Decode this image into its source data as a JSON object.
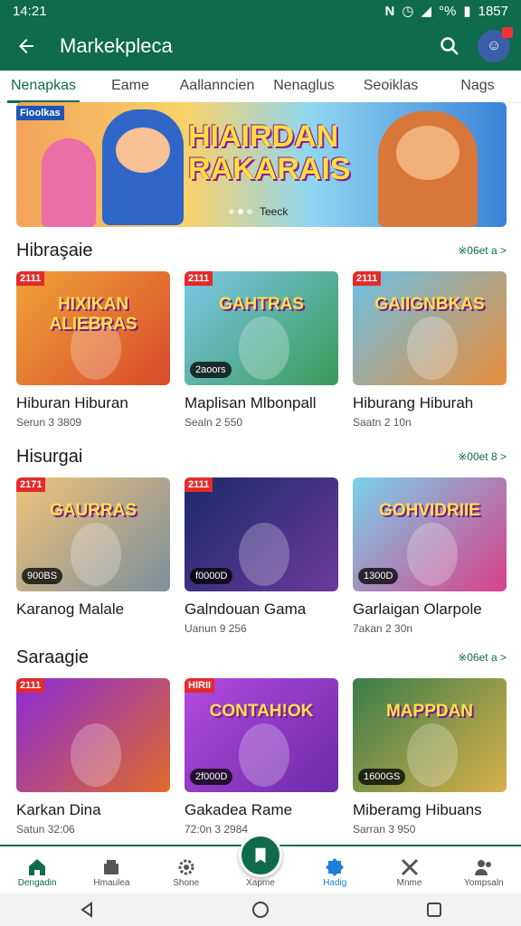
{
  "status": {
    "time": "14:21",
    "battery_text": "°%",
    "clock_right": "1857"
  },
  "appbar": {
    "title": "Markekpleca",
    "search_icon": "search-icon",
    "back_icon": "back-arrow-icon"
  },
  "tabs": [
    {
      "label": "Nenapkas",
      "active": true
    },
    {
      "label": "Eame"
    },
    {
      "label": "Aallanncien"
    },
    {
      "label": "Nenaglus"
    },
    {
      "label": "Seoiklas"
    },
    {
      "label": "Nags"
    }
  ],
  "banner": {
    "tag": "Fioolkas",
    "headline_line1": "HIAIRDAN",
    "headline_line2": "RAKARAIS",
    "caption": "Teeck",
    "pages": 3,
    "active_page": 2
  },
  "sections": [
    {
      "title": "Hibraşaie",
      "more": "※06et a >",
      "cards": [
        {
          "name": "Hiburan Hiburan",
          "meta": "Serun 3 3809",
          "ribbon": "2111",
          "cover_text": "HIXIKAN ALIEBRAS",
          "colors": [
            "#f0a33a",
            "#d84a2a"
          ]
        },
        {
          "name": "Maplisan Mlbonpall",
          "meta": "Sealn 2 550",
          "ribbon": "2111",
          "pill": "2aoors",
          "cover_text": "GAHTRAS",
          "colors": [
            "#7cc7e8",
            "#3a9b5a"
          ]
        },
        {
          "name": "Hiburang Hiburah",
          "meta": "Saatn 2 10n",
          "ribbon": "2111",
          "cover_text": "GAIIGNBKAS",
          "colors": [
            "#6bc0e6",
            "#e88d3a"
          ]
        }
      ]
    },
    {
      "title": "Hisurgai",
      "more": "※00et 8 >",
      "cards": [
        {
          "name": "Karanog Malale",
          "meta": "",
          "ribbon": "2171",
          "pill": "900BS",
          "cover_text": "GAURRAS",
          "colors": [
            "#f1c27a",
            "#7c8f9c"
          ]
        },
        {
          "name": "Galndouan Gama",
          "meta": "Uanun 9 256",
          "ribbon": "2111",
          "pill": "f0000D",
          "cover_text": "",
          "colors": [
            "#1b2a6b",
            "#6b3a9b"
          ]
        },
        {
          "name": "Garlaigan Olarpole",
          "meta": "7akan 2 30n",
          "ribbon": "",
          "pill": "1300D",
          "cover_text": "GOHVIDRIIE",
          "colors": [
            "#7ad1ea",
            "#d8408a"
          ]
        }
      ]
    },
    {
      "title": "Saraagie",
      "more": "※06et a >",
      "cards": [
        {
          "name": "Karkan Dina",
          "meta": "Satun 32:06",
          "ribbon": "2111",
          "cover_text": "",
          "colors": [
            "#8a2bd8",
            "#e06a2a"
          ]
        },
        {
          "name": "Gakadea Rame",
          "meta": "72:0n 3 2984",
          "ribbon": "HIRII",
          "pill": "2f000D",
          "cover_text": "CONTAH!OK",
          "colors": [
            "#b34adf",
            "#6b2aa8"
          ]
        },
        {
          "name": "Miberamg Hibuans",
          "meta": "Sarran 3 950",
          "ribbon": "",
          "pill": "1600GS",
          "cover_text": "MAPPDAN",
          "colors": [
            "#3a7d4a",
            "#d8b04a"
          ]
        }
      ]
    }
  ],
  "bottom_nav": [
    {
      "label": "Dengadin",
      "icon": "home-icon",
      "active": true
    },
    {
      "label": "Hmaulea",
      "icon": "store-icon"
    },
    {
      "label": "Shone",
      "icon": "gear-icon"
    },
    {
      "label": "Xapme",
      "icon": "bookmark-icon"
    },
    {
      "label": "Hadig",
      "icon": "badge-icon",
      "blue": true
    },
    {
      "label": "Mnme",
      "icon": "tools-icon"
    },
    {
      "label": "Yompsaln",
      "icon": "people-icon"
    }
  ],
  "system_nav": {
    "back": "back-triangle-icon",
    "home": "home-circle-icon",
    "recents": "recents-square-icon"
  }
}
